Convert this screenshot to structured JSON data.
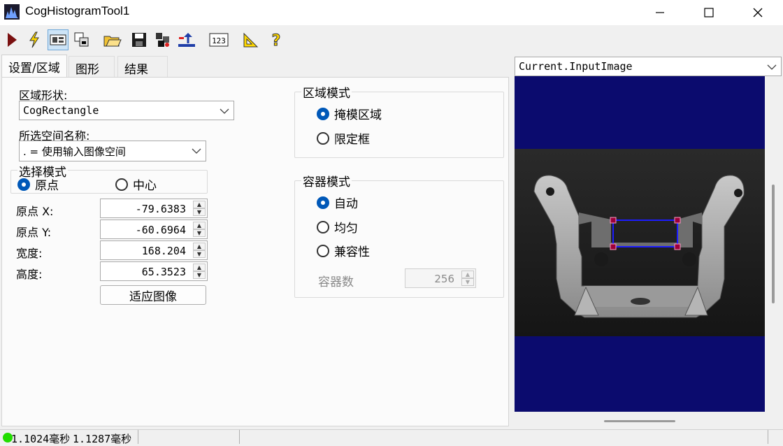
{
  "window": {
    "title": "CogHistogramTool1"
  },
  "toolbar": {
    "items": [
      "run-icon",
      "lightning-icon",
      "image-display-icon",
      "copy-region-icon",
      "open-icon",
      "save-icon",
      "settings-icon",
      "reset-icon",
      "number-display-icon",
      "measure-icon",
      "help-icon"
    ]
  },
  "tabs": [
    "设置/区域",
    "图形",
    "结果"
  ],
  "region": {
    "shape_label": "区域形状:",
    "shape_value": "CogRectangle",
    "space_label": "所选空间名称:",
    "space_value": ". = 使用输入图像空间",
    "select_mode_title": "选择模式",
    "select_mode_options": [
      "原点",
      "中心"
    ],
    "select_mode_selected": "原点",
    "fields": [
      {
        "label": "原点 X:",
        "value": "-79.6383"
      },
      {
        "label": "原点 Y:",
        "value": "-60.6964"
      },
      {
        "label": "宽度:",
        "value": "168.204"
      },
      {
        "label": "高度:",
        "value": "65.3523"
      }
    ],
    "fit_button": "适应图像"
  },
  "region_mode": {
    "title": "区域模式",
    "options": [
      "掩模区域",
      "限定框"
    ],
    "selected": "掩模区域"
  },
  "bin_mode": {
    "title": "容器模式",
    "options": [
      "自动",
      "均匀",
      "兼容性"
    ],
    "selected": "自动",
    "bins_label": "容器数",
    "bins_value": "256"
  },
  "image": {
    "selector": "Current.InputImage",
    "colors": {
      "background": "#0b0b6e",
      "roi": "#1c1cff",
      "handle": "#9b0038"
    }
  },
  "status": {
    "indicator_color": "#22dd00",
    "time1": "1.1024毫秒",
    "time2": "1.1287毫秒"
  }
}
